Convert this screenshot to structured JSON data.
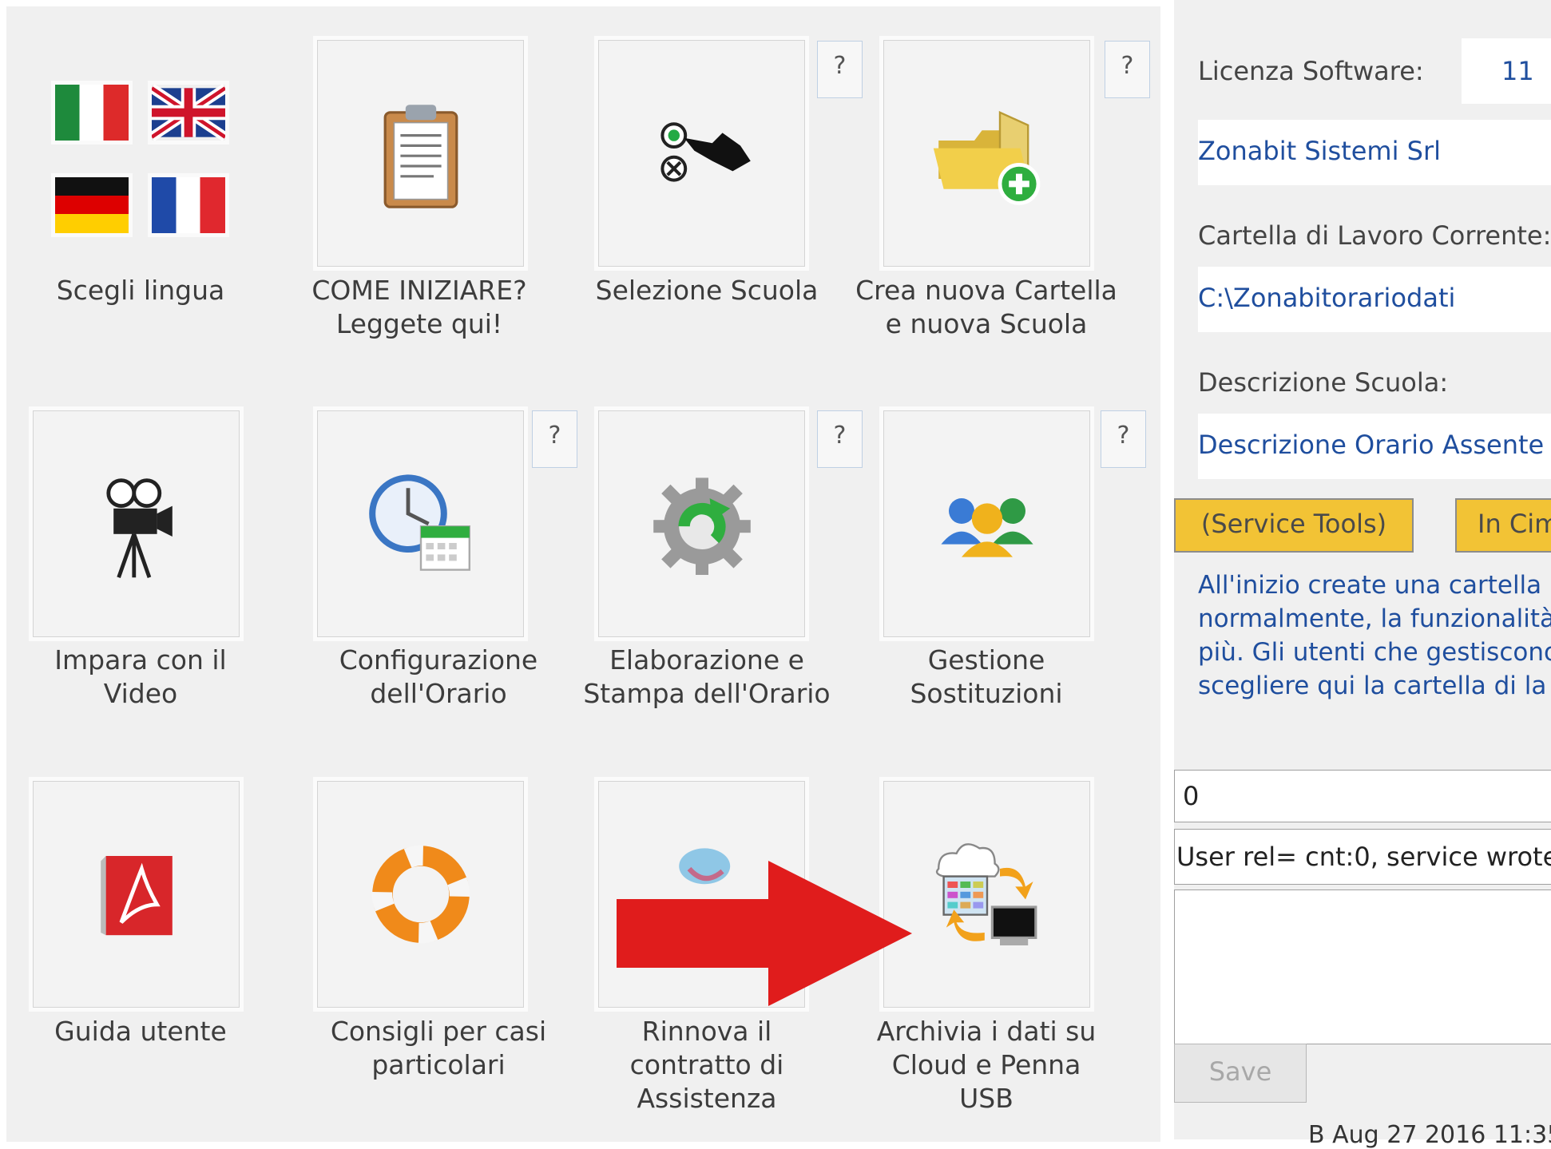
{
  "tiles": [
    {
      "label": "Scegli lingua",
      "help": ""
    },
    {
      "label": "COME INIZIARE?\nLeggete qui!",
      "help": ""
    },
    {
      "label": "Selezione Scuola",
      "help": "?"
    },
    {
      "label": "Crea nuova Cartella\ne nuova Scuola",
      "help": "?"
    },
    {
      "label": "Impara con il\nVideo",
      "help": ""
    },
    {
      "label": "Configurazione\ndell'Orario",
      "help": "?"
    },
    {
      "label": "Elaborazione e\nStampa dell'Orario",
      "help": "?"
    },
    {
      "label": "Gestione\nSostituzioni",
      "help": "?"
    },
    {
      "label": "Guida utente",
      "help": ""
    },
    {
      "label": "Consigli per casi\nparticolari",
      "help": ""
    },
    {
      "label": "Rinnova il\ncontratto di\nAssistenza",
      "help": ""
    },
    {
      "label": "Archivia i dati su\nCloud e Penna\nUSB",
      "help": ""
    }
  ],
  "right_panel": {
    "license_label": "Licenza Software:",
    "license_value": "11",
    "company": "Zonabit Sistemi Srl",
    "folder_label": "Cartella di Lavoro Corrente:",
    "folder_value": "C:\\Zonabitorariodati",
    "school_label": "Descrizione Scuola:",
    "school_value": "Descrizione Orario Assente",
    "service_tools_label": "(Service Tools)",
    "second_button_label": "In Cim",
    "info_lines": [
      "All'inizio create una cartella",
      "normalmente, la funzionalità",
      "più. Gli utenti che gestiscono",
      "scegliere qui la cartella di la"
    ],
    "field_value": "0",
    "status_text": "User rel= cnt:0, service wrote:",
    "save_label": "Save",
    "footer_text": "B Aug 27 2016 11:35"
  },
  "colors": {
    "accent_blue": "#1f4e9e",
    "service_button": "#f2c335",
    "arrow_red": "#e01c1c"
  },
  "icons": {
    "language_flags": [
      "italy-flag",
      "uk-flag",
      "germany-flag",
      "france-flag"
    ],
    "tile_icons": [
      "clipboard-icon",
      "select-hand-icon",
      "folder-add-icon",
      "video-camera-icon",
      "clock-calendar-icon",
      "gear-refresh-icon",
      "users-group-icon",
      "pdf-icon",
      "lifebuoy-icon",
      "renew-icon",
      "cloud-sync-icon"
    ]
  }
}
